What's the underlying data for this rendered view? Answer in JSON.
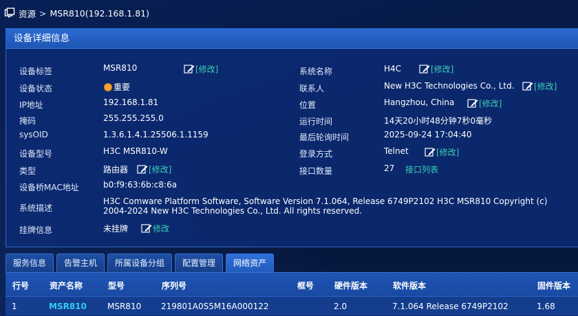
{
  "breadcrumb": {
    "root": "资源",
    "separator": ">",
    "current": "MSR810(192.168.1.81)"
  },
  "panel": {
    "title": "设备详细信息",
    "left": {
      "device_label": {
        "label": "设备标签",
        "value": "MSR810",
        "edit": "[修改]"
      },
      "device_status": {
        "label": "设备状态",
        "value": "重要",
        "status_color": "#f2a33a"
      },
      "ip": {
        "label": "IP地址",
        "value": "192.168.1.81"
      },
      "mask": {
        "label": "掩码",
        "value": "255.255.255.0"
      },
      "sysoid": {
        "label": "sysOID",
        "value": "1.3.6.1.4.1.25506.1.1159"
      },
      "model": {
        "label": "设备型号",
        "value": "H3C MSR810-W"
      },
      "type": {
        "label": "类型",
        "value": "路由器",
        "edit": "[修改]"
      },
      "mac": {
        "label": "设备桥MAC地址",
        "value": "b0:f9:63:6b:c8:6a"
      },
      "description": {
        "label": "系统描述",
        "value": "H3C Comware Platform Software, Software Version 7.1.064, Release 6749P2102 H3C MSR810 Copyright (c) 2004-2024 New H3C Technologies Co., Ltd. All rights reserved."
      },
      "tag_info": {
        "label": "挂牌信息",
        "value": "未挂牌",
        "edit": "修改"
      }
    },
    "right": {
      "sys_name": {
        "label": "系统名称",
        "value": "H4C",
        "edit": "[修改]"
      },
      "contact": {
        "label": "联系人",
        "value": "New H3C Technologies Co., Ltd.",
        "edit": "[修改]"
      },
      "location": {
        "label": "位置",
        "value": "Hangzhou, China",
        "edit": "[修改]"
      },
      "uptime": {
        "label": "运行时间",
        "value": "14天20小时48分钟7秒0毫秒"
      },
      "last_poll": {
        "label": "最后轮询时间",
        "value": "2025-09-24 17:04:40"
      },
      "login": {
        "label": "登录方式",
        "value": "Telnet",
        "edit": "[修改]"
      },
      "interfaces": {
        "label": "接口数量",
        "value": "27",
        "link": "接口列表"
      }
    }
  },
  "tabs": [
    {
      "label": "服务信息",
      "active": false
    },
    {
      "label": "告警主机",
      "active": false
    },
    {
      "label": "所属设备分组",
      "active": false
    },
    {
      "label": "配置管理",
      "active": false
    },
    {
      "label": "网络资产",
      "active": true
    }
  ],
  "table": {
    "columns": [
      "行号",
      "资产名称",
      "型号",
      "序列号",
      "框号",
      "硬件版本",
      "软件版本",
      "固件版本"
    ],
    "rows": [
      [
        "1",
        "MSR810",
        "MSR810",
        "219801A0S5M16A000122",
        "",
        "2.0",
        "7.1.064 Release 6749P2102",
        "1.68"
      ]
    ]
  },
  "colors": {
    "accent_link": "#39d0b5",
    "asset_link": "#33ccf0",
    "panel_header": "#2a6ad1",
    "background": "#07183f"
  }
}
